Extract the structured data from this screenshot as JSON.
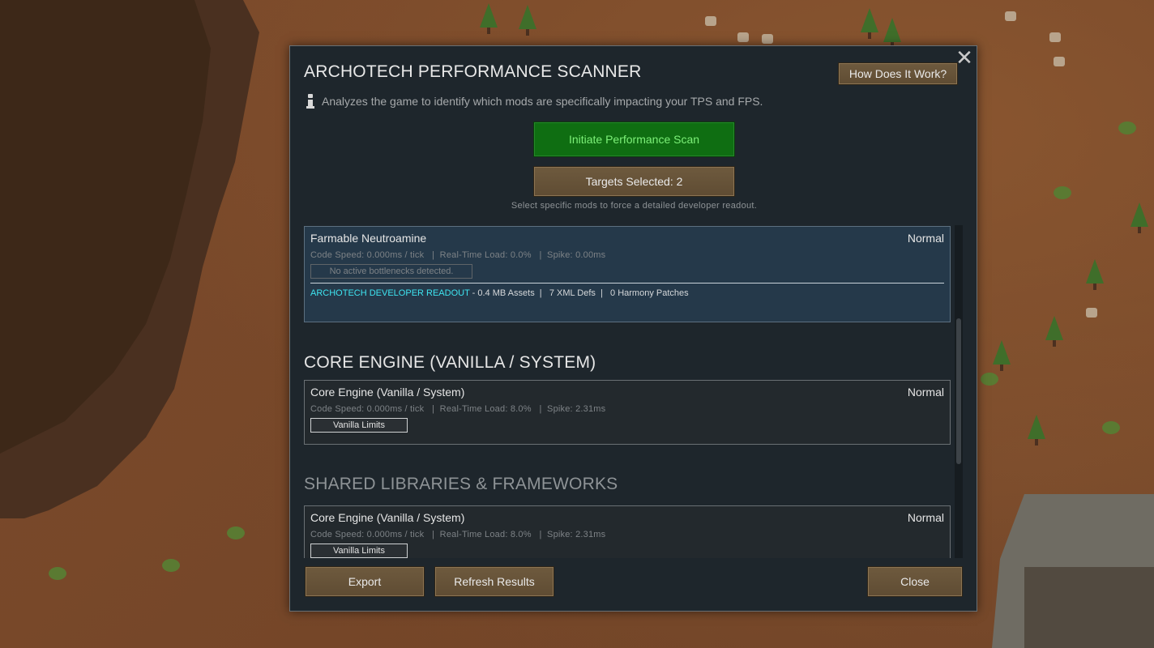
{
  "dialog": {
    "title": "ARCHOTECH PERFORMANCE SCANNER",
    "how_button": "How Does It Work?",
    "close_glyph": "✕",
    "info_text": "Analyzes the game to identify which mods are specifically impacting your TPS and FPS.",
    "scan_button": "Initiate Performance Scan",
    "targets_button": "Targets Selected: 2",
    "targets_hint": "Select specific mods to force a detailed developer readout."
  },
  "entries": [
    {
      "name": "Farmable Neutroamine",
      "status": "Normal",
      "stats": "Code Speed: 0.000ms / tick   |  Real-Time Load: 0.0%   |  Spike: 0.00ms",
      "tag": "No active bottlenecks detected.",
      "readout_label": "ARCHOTECH DEVELOPER READOUT",
      "readout_text": " - 0.4 MB Assets  |   7 XML Defs  |   0 Harmony Patches"
    }
  ],
  "sections": [
    {
      "heading": "CORE ENGINE (VANILLA / SYSTEM)",
      "entry": {
        "name": "Core Engine (Vanilla / System)",
        "status": "Normal",
        "stats": "Code Speed: 0.000ms / tick   |  Real-Time Load: 8.0%   |  Spike: 2.31ms",
        "tag": "Vanilla Limits"
      }
    },
    {
      "heading": "SHARED LIBRARIES & FRAMEWORKS",
      "entry": {
        "name": "Core Engine (Vanilla / System)",
        "status": "Normal",
        "stats": "Code Speed: 0.000ms / tick   |  Real-Time Load: 8.0%   |  Spike: 2.31ms",
        "tag": "Vanilla Limits"
      }
    }
  ],
  "footer": {
    "export": "Export",
    "refresh": "Refresh Results",
    "close": "Close"
  },
  "colors": {
    "scan_green": "#0f6e12",
    "button_brown": "#6e5a3e",
    "readout_cyan": "#3ee4f0",
    "dialog_bg": "#1e262c"
  },
  "icons": [
    "info-icon",
    "close-icon"
  ]
}
